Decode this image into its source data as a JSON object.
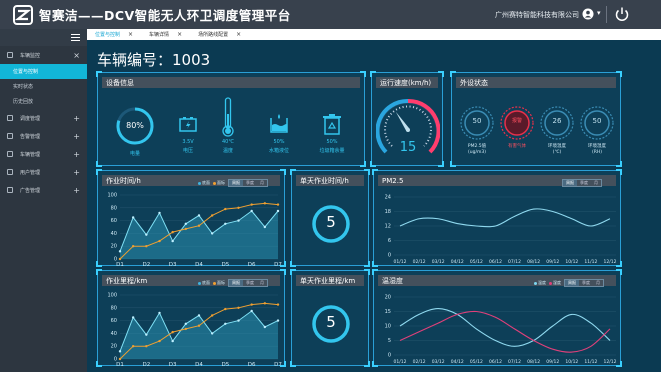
{
  "header": {
    "app_title": "智赛洁——DCV智能无人环卫调度管理平台",
    "company": "广州赛特智能科技有限公司"
  },
  "sidebar": {
    "items": [
      {
        "label": "车辆监控",
        "expanded": true,
        "sub": [
          {
            "label": "位置与控制",
            "active": true
          },
          {
            "label": "实时状态",
            "active": false
          },
          {
            "label": "历史回放",
            "active": false
          }
        ]
      },
      {
        "label": "调度管理"
      },
      {
        "label": "告警管理"
      },
      {
        "label": "车辆管理"
      },
      {
        "label": "用户管理"
      },
      {
        "label": "广告管理"
      }
    ]
  },
  "tabs": [
    {
      "label": "位置与控制",
      "active": true
    },
    {
      "label": "车辆详情",
      "active": false
    },
    {
      "label": "场所路线配置",
      "active": false
    }
  ],
  "vehicle": {
    "label": "车辆编号：",
    "number": "1003"
  },
  "device_info": {
    "title": "设备信息",
    "battery": {
      "value": "80%",
      "percent": 80,
      "label": "电量"
    },
    "voltage": {
      "value": "3.5V",
      "label": "电压",
      "icon": "battery-bolt-icon"
    },
    "temperature": {
      "value": "40℃",
      "label": "温度",
      "icon": "thermometer-icon"
    },
    "water": {
      "value": "50%",
      "label": "水箱液位",
      "icon": "water-tank-icon"
    },
    "garbage": {
      "value": "50%",
      "label": "垃圾箱余量",
      "icon": "recycle-bin-icon"
    }
  },
  "speed": {
    "title": "运行速度(km/h)",
    "value": "15",
    "max": 40
  },
  "environment": {
    "title": "外设状态",
    "gauges": [
      {
        "value": "50",
        "label": "PM2.5值\n(ug/m3)",
        "alarm": false
      },
      {
        "value": "报警",
        "label": "有害气体",
        "alarm": true
      },
      {
        "value": "26",
        "label": "环境温度\n(℃)",
        "alarm": false
      },
      {
        "value": "50",
        "label": "环境湿度\n(RH)",
        "alarm": false
      }
    ]
  },
  "work_time": {
    "title": "作业时间/h",
    "legend": [
      "底面",
      "面标"
    ],
    "segments": [
      "周报",
      "季度",
      "月"
    ],
    "single_title": "单天作业时间/h",
    "single_value": "5"
  },
  "work_distance": {
    "title": "作业里程/km",
    "legend": [
      "底面",
      "面标"
    ],
    "segments": [
      "周报",
      "季度",
      "月"
    ],
    "single_title": "单天作业里程/km",
    "single_value": "5"
  },
  "pm25": {
    "title": "PM2.5",
    "segments": [
      "周报",
      "季度",
      "月"
    ]
  },
  "temp_humidity": {
    "title": "温湿度",
    "legend": [
      "温度",
      "湿度"
    ],
    "segments": [
      "周报",
      "季度",
      "月"
    ]
  },
  "chart_data": [
    {
      "type": "area",
      "title": "作业时间/h",
      "categories": [
        "D1",
        "D2",
        "D3",
        "D4",
        "D5",
        "D6",
        "D7"
      ],
      "ylim": [
        0,
        100
      ],
      "yticks": [
        0,
        20,
        40,
        60,
        80,
        100
      ],
      "series": [
        {
          "name": "底面",
          "values": [
            12,
            65,
            38,
            72,
            28,
            55,
            68,
            40,
            55,
            60,
            75,
            50,
            75
          ]
        },
        {
          "name": "面标",
          "values": [
            0,
            20,
            20,
            28,
            42,
            47,
            52,
            68,
            78,
            80,
            85,
            87,
            85
          ]
        }
      ]
    },
    {
      "type": "area",
      "title": "作业里程/km",
      "categories": [
        "D1",
        "D2",
        "D3",
        "D4",
        "D5",
        "D6",
        "D7"
      ],
      "ylim": [
        0,
        100
      ],
      "yticks": [
        0,
        20,
        40,
        60,
        80,
        100
      ],
      "series": [
        {
          "name": "底面",
          "values": [
            12,
            65,
            38,
            72,
            28,
            55,
            68,
            40,
            55,
            60,
            75,
            50,
            60
          ]
        },
        {
          "name": "面标",
          "values": [
            0,
            20,
            20,
            28,
            42,
            47,
            52,
            68,
            78,
            80,
            85,
            87,
            85
          ]
        }
      ]
    },
    {
      "type": "line",
      "title": "PM2.5",
      "categories": [
        "01/12",
        "02/12",
        "03/12",
        "04/12",
        "05/12",
        "06/12",
        "07/12",
        "08/12",
        "09/12",
        "10/12",
        "11/12",
        "12/12"
      ],
      "ylim": [
        0,
        24
      ],
      "yticks": [
        0,
        6,
        12,
        18,
        24
      ],
      "series": [
        {
          "values": [
            12,
            15,
            15,
            13,
            12,
            12,
            16,
            19,
            18,
            15,
            12,
            15
          ]
        }
      ]
    },
    {
      "type": "line",
      "title": "温湿度",
      "categories": [
        "01/12",
        "02/12",
        "03/12",
        "04/12",
        "05/12",
        "06/12",
        "07/12",
        "08/12",
        "09/12",
        "10/12",
        "11/12",
        "12/12"
      ],
      "ylim": [
        0,
        20
      ],
      "yticks": [
        0,
        5,
        10,
        15,
        20
      ],
      "series": [
        {
          "name": "温度",
          "values": [
            10,
            14,
            16,
            14,
            9,
            5,
            3,
            5,
            10,
            14,
            11,
            5
          ]
        },
        {
          "name": "湿度",
          "values": [
            5,
            8,
            11,
            14,
            15,
            13,
            9,
            5,
            2,
            1,
            3,
            9
          ]
        }
      ]
    }
  ]
}
